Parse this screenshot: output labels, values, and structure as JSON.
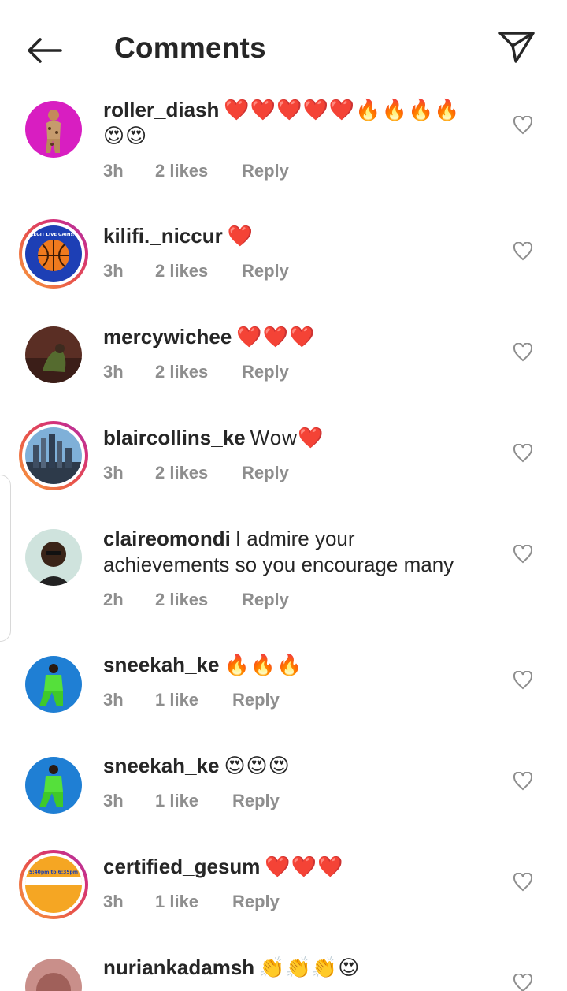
{
  "header": {
    "title": "Comments"
  },
  "comments": [
    {
      "username": "roller_diash",
      "text": "❤️❤️❤️❤️❤️🔥🔥🔥🔥😍😍",
      "time": "3h",
      "likes": "2 likes",
      "reply": "Reply"
    },
    {
      "username": "kilifi._niccur",
      "text": "❤️",
      "time": "3h",
      "likes": "2 likes",
      "reply": "Reply",
      "avatar_text": "LEGIT LIVE GAIN!!!"
    },
    {
      "username": "mercywichee",
      "text": "❤️❤️❤️",
      "time": "3h",
      "likes": "2 likes",
      "reply": "Reply"
    },
    {
      "username": "blaircollins_ke",
      "text": "Wow❤️",
      "time": "3h",
      "likes": "2 likes",
      "reply": "Reply"
    },
    {
      "username": "claireomondi",
      "text": "I  admire your achievements so you encourage many",
      "time": "2h",
      "likes": "2 likes",
      "reply": "Reply"
    },
    {
      "username": "sneekah_ke",
      "text": "🔥🔥🔥",
      "time": "3h",
      "likes": "1 like",
      "reply": "Reply"
    },
    {
      "username": "sneekah_ke",
      "text": "😍😍😍",
      "time": "3h",
      "likes": "1 like",
      "reply": "Reply"
    },
    {
      "username": "certified_gesum",
      "text": "❤️❤️❤️",
      "time": "3h",
      "likes": "1 like",
      "reply": "Reply",
      "avatar_text": "5:40pm to 6:35pm"
    },
    {
      "username": "nuriankadamsh",
      "text": "👏👏👏😍"
    }
  ],
  "icons": {
    "back": "back-arrow-icon",
    "send": "paper-plane-icon",
    "like": "heart-outline-icon"
  },
  "colors": {
    "text": "#262626",
    "meta": "#8e8e8e",
    "story_ring": "#e8544a"
  }
}
